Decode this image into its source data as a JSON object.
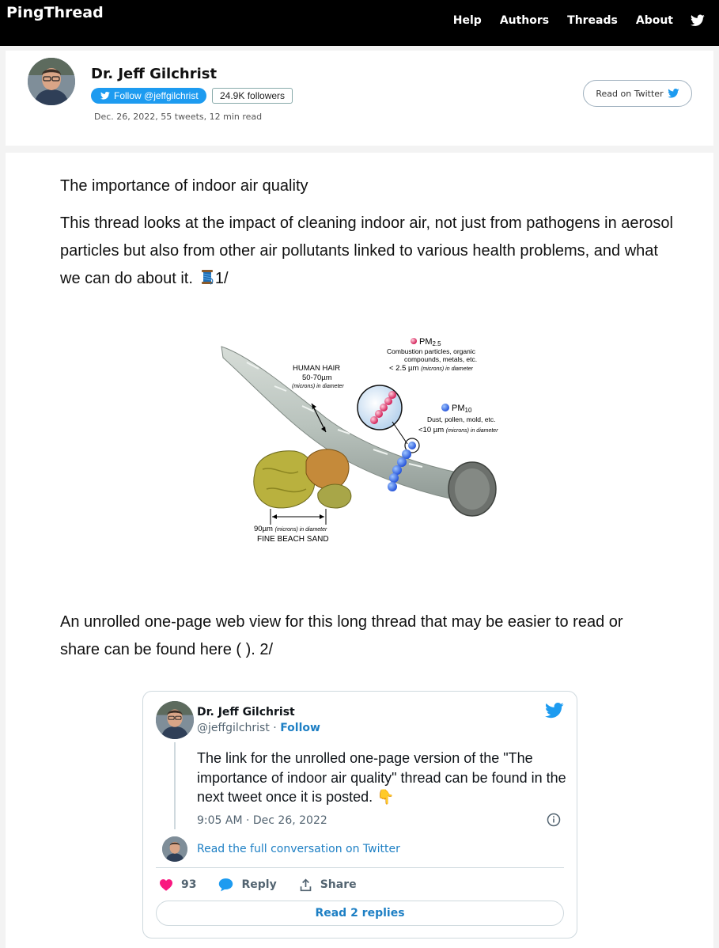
{
  "nav": {
    "brand": "PingThread",
    "links": [
      "Help",
      "Authors",
      "Threads",
      "About"
    ],
    "twitter_icon": "twitter-bird-icon"
  },
  "author": {
    "name": "Dr. Jeff Gilchrist",
    "follow_label": "Follow @jeffgilchrist",
    "followers": "24.9K followers",
    "meta": "Dec. 26, 2022, 55 tweets, 12 min read",
    "read_on_twitter": "Read on Twitter"
  },
  "thread": {
    "heading": "The importance of indoor air quality",
    "tweet1": "This thread looks at the impact of cleaning indoor air, not just from pathogens in aerosol particles but also from other air pollutants linked to various health problems, and what we can do about it.",
    "tweet1_suffix": "1/",
    "tweet2": "An unrolled one-page web view for this long thread that may be easier to read or share can be found here ( ). 2/"
  },
  "figure": {
    "pm25_title": "PM",
    "pm25_sub": "2.5",
    "pm25_desc1": "Combustion particles, organic",
    "pm25_desc2": "compounds, metals, etc.",
    "pm25_size": "< 2.5 µm",
    "pm25_size_note": "(microns) in diameter",
    "pm10_title": "PM",
    "pm10_sub": "10",
    "pm10_desc": "Dust, pollen, mold, etc.",
    "pm10_size": "<10 µm",
    "pm10_size_note": "(microns) in diameter",
    "hair_title": "HUMAN HAIR",
    "hair_size": "50-70µm",
    "hair_note": "(microns) in diameter",
    "sand_size": "90µm",
    "sand_note": "(microns) in diameter",
    "sand_title": "FINE BEACH SAND"
  },
  "embedded_tweet": {
    "name": "Dr. Jeff Gilchrist",
    "handle": "@jeffgilchrist",
    "separator": " · ",
    "follow": "Follow",
    "text": "The link for the unrolled one-page version of the \"The importance of indoor air quality\" thread can be found in the next tweet once it is posted. 👇",
    "timestamp": "9:05 AM · Dec 26, 2022",
    "conversation_link": "Read the full conversation on Twitter",
    "likes": "93",
    "reply_label": "Reply",
    "share_label": "Share",
    "read_replies": "Read 2 replies",
    "colors": {
      "like": "#f91880",
      "link": "#1d7fc4",
      "brand": "#1d9bf0"
    }
  }
}
